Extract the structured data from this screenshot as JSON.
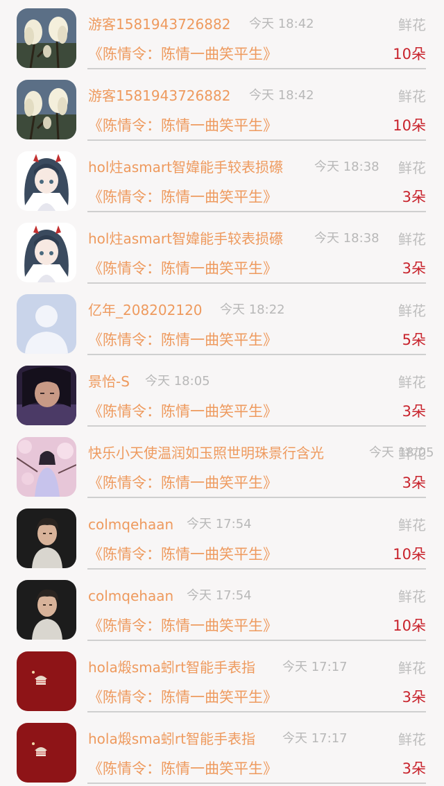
{
  "records": [
    {
      "avatar": "magnolia-flower-avatar",
      "name": "游客1581943726882",
      "time": "今天 18:42",
      "gift": "鲜花",
      "work": "《陈情令：陈情一曲笑平生》",
      "count": "10朵"
    },
    {
      "avatar": "magnolia-flower-avatar",
      "name": "游客1581943726882",
      "time": "今天 18:42",
      "gift": "鲜花",
      "work": "《陈情令：陈情一曲笑平生》",
      "count": "10朵"
    },
    {
      "avatar": "anime-girl-avatar",
      "name": "hol炷asmart智媁能手较表损礤",
      "time": "今天 18:38",
      "gift": "鲜花",
      "work": "《陈情令：陈情一曲笑平生》",
      "count": "3朵"
    },
    {
      "avatar": "anime-girl-avatar",
      "name": "hol炷asmart智媁能手较表损礤",
      "time": "今天 18:38",
      "gift": "鲜花",
      "work": "《陈情令：陈情一曲笑平生》",
      "count": "3朵"
    },
    {
      "avatar": "default-person-avatar",
      "name": "亿年_208202120",
      "time": "今天 18:22",
      "gift": "鲜花",
      "work": "《陈情令：陈情一曲笑平生》",
      "count": "5朵"
    },
    {
      "avatar": "dark-portrait-avatar",
      "name": "景怡-S",
      "time": "今天 18:05",
      "gift": "鲜花",
      "work": "《陈情令：陈情一曲笑平生》",
      "count": "3朵"
    },
    {
      "avatar": "blossom-girl-avatar",
      "name": "快乐小天使温润如玉照世明珠景行含光",
      "time": "今天 18:05",
      "gift": "鲜花",
      "work": "《陈情令：陈情一曲笑平生》",
      "count": "3朵"
    },
    {
      "avatar": "young-man-avatar",
      "name": "colmqehaan",
      "time": "今天 17:54",
      "gift": "鲜花",
      "work": "《陈情令：陈情一曲笑平生》",
      "count": "10朵"
    },
    {
      "avatar": "young-man-avatar",
      "name": "colmqehaan",
      "time": "今天 17:54",
      "gift": "鲜花",
      "work": "《陈情令：陈情一曲笑平生》",
      "count": "10朵"
    },
    {
      "avatar": "red-logo-avatar",
      "name": "hola煅sma蚓rt智能手表指",
      "time": "今天 17:17",
      "gift": "鲜花",
      "work": "《陈情令：陈情一曲笑平生》",
      "count": "3朵"
    },
    {
      "avatar": "red-logo-avatar",
      "name": "hola煅sma蚓rt智能手表指",
      "time": "今天 17:17",
      "gift": "鲜花",
      "work": "《陈情令：陈情一曲笑平生》",
      "count": "3朵"
    }
  ],
  "colors": {
    "name": "#ee9a5e",
    "time": "#b8b8b8",
    "gift_type": "#bdbdbd",
    "count": "#c8232c",
    "background": "#f8f6f6"
  }
}
